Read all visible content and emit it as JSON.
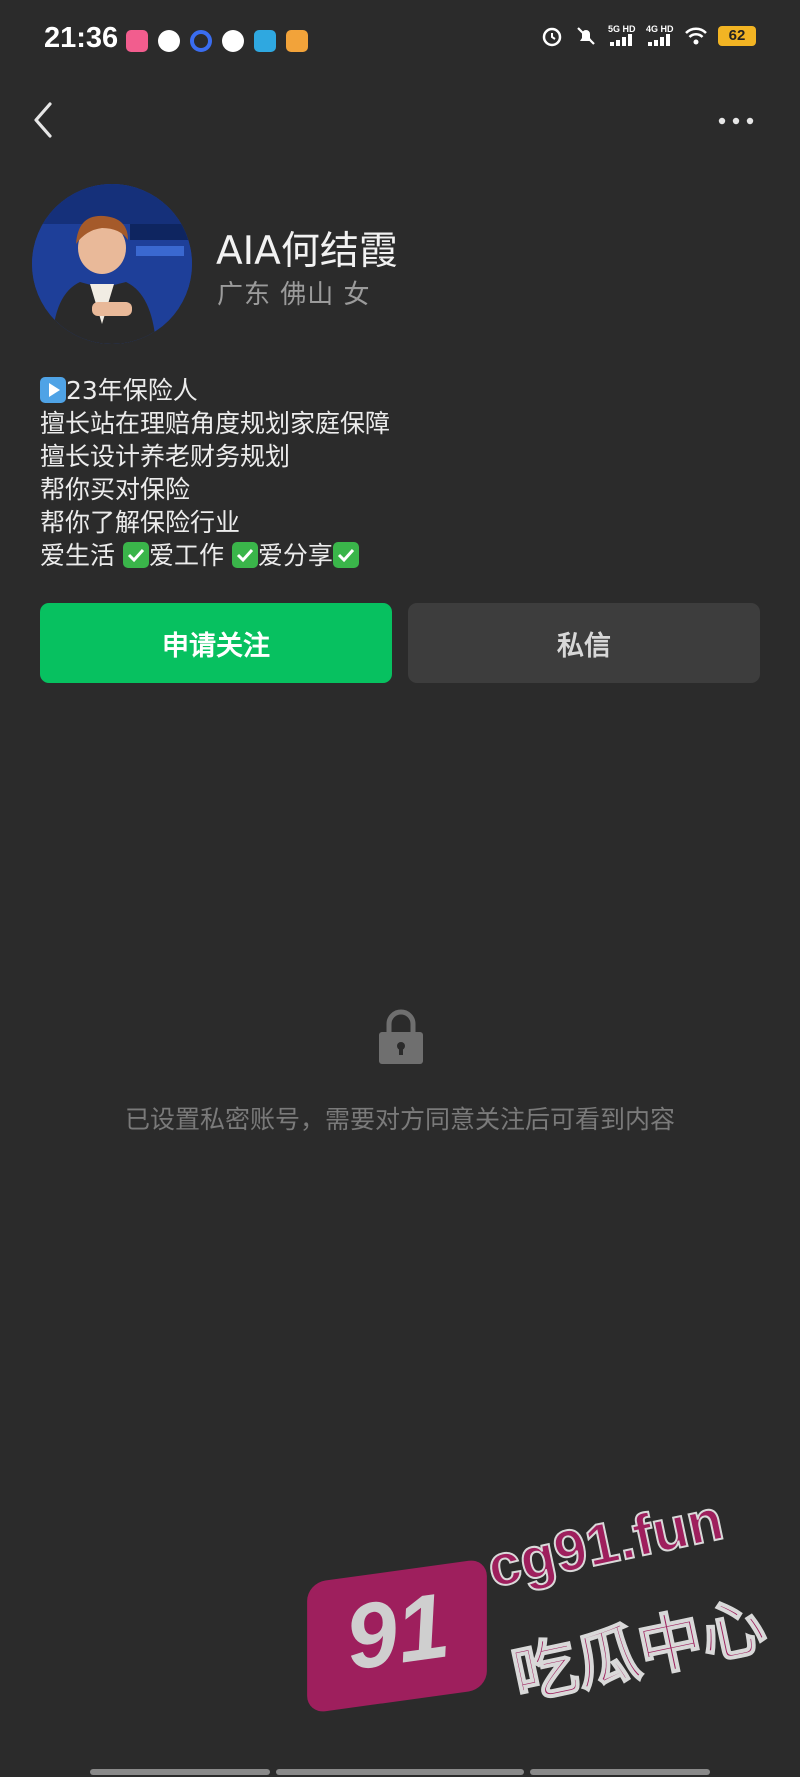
{
  "status_bar": {
    "time": "21:36",
    "network_1": "5G HD",
    "network_2": "4G HD",
    "battery": "62"
  },
  "profile": {
    "name": "AIA何结霞",
    "location": "广东 佛山 女"
  },
  "bio": {
    "line1": "23年保险人",
    "line2": "擅长站在理赔角度规划家庭保障",
    "line3": "擅长设计养老财务规划",
    "line4": "帮你买对保险",
    "line5": "帮你了解保险行业",
    "line6_a": "爱生活 ",
    "line6_b": "爱工作 ",
    "line6_c": "爱分享"
  },
  "actions": {
    "follow_label": "申请关注",
    "message_label": "私信"
  },
  "private_notice": "已设置私密账号，需要对方同意关注后可看到内容",
  "watermark": {
    "number": "91",
    "url": "cg91.fun",
    "text": "吃瓜中心"
  },
  "colors": {
    "background": "#2b2b2b",
    "follow_button": "#07c160",
    "message_button": "#3d3d3d"
  }
}
